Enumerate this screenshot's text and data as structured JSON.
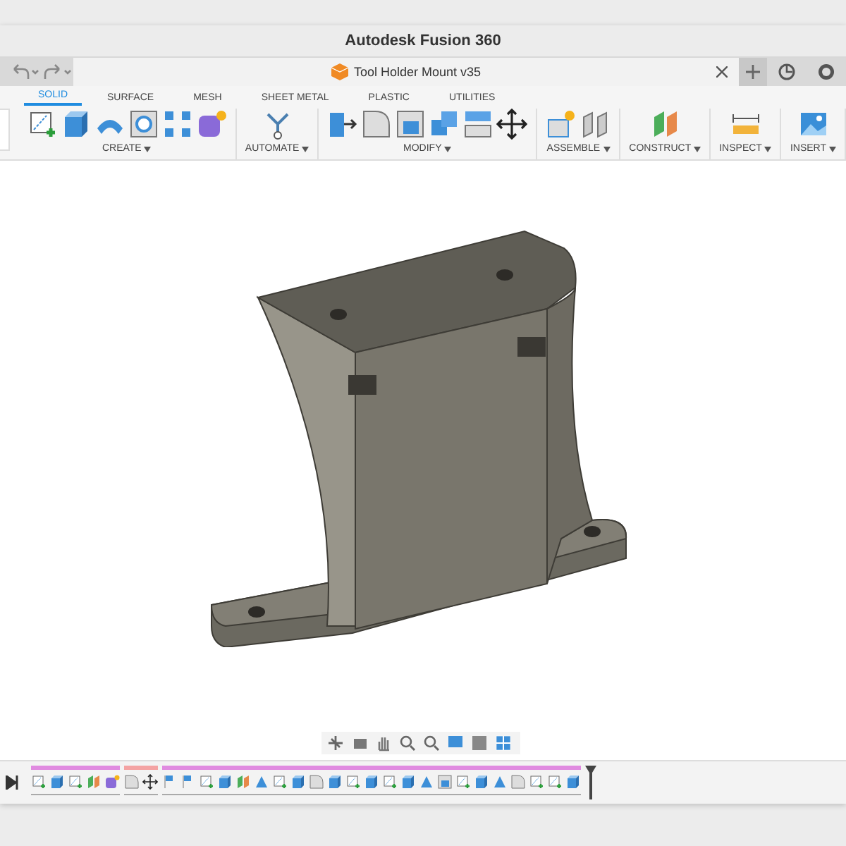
{
  "window": {
    "title": "Autodesk Fusion 360"
  },
  "document_tab": {
    "title": "Tool Holder Mount v35"
  },
  "workspace_tabs": [
    {
      "label": "SOLID",
      "selected": true
    },
    {
      "label": "SURFACE",
      "selected": false
    },
    {
      "label": "MESH",
      "selected": false
    },
    {
      "label": "SHEET METAL",
      "selected": false
    },
    {
      "label": "PLASTIC",
      "selected": false
    },
    {
      "label": "UTILITIES",
      "selected": false
    }
  ],
  "toolbar_groups": [
    {
      "label": "CREATE",
      "tools": [
        {
          "kind": "sketch"
        },
        {
          "kind": "extrude"
        },
        {
          "kind": "revolve"
        },
        {
          "kind": "hole"
        },
        {
          "kind": "pattern"
        },
        {
          "kind": "form"
        }
      ]
    },
    {
      "label": "AUTOMATE",
      "tools": [
        {
          "kind": "automate"
        }
      ]
    },
    {
      "label": "MODIFY",
      "tools": [
        {
          "kind": "presspull"
        },
        {
          "kind": "fillet"
        },
        {
          "kind": "shell"
        },
        {
          "kind": "combine"
        },
        {
          "kind": "offset"
        },
        {
          "kind": "move"
        }
      ]
    },
    {
      "label": "ASSEMBLE",
      "tools": [
        {
          "kind": "component"
        },
        {
          "kind": "joint"
        }
      ]
    },
    {
      "label": "CONSTRUCT",
      "tools": [
        {
          "kind": "plane"
        }
      ]
    },
    {
      "label": "INSPECT",
      "tools": [
        {
          "kind": "measure"
        }
      ]
    },
    {
      "label": "INSERT",
      "tools": [
        {
          "kind": "image"
        }
      ]
    }
  ],
  "timeline_groups": [
    {
      "color": "#e08be0",
      "items": [
        {
          "kind": "sketch"
        },
        {
          "kind": "extrude"
        },
        {
          "kind": "sketch"
        },
        {
          "kind": "plane"
        },
        {
          "kind": "form"
        }
      ]
    },
    {
      "color": "#f4a3a3",
      "items": [
        {
          "kind": "fillet"
        },
        {
          "kind": "move"
        }
      ]
    },
    {
      "color": "#e08be0",
      "items": [
        {
          "kind": "flag"
        },
        {
          "kind": "flag"
        },
        {
          "kind": "sketch"
        },
        {
          "kind": "extrude"
        },
        {
          "kind": "plane"
        },
        {
          "kind": "draft"
        },
        {
          "kind": "sketch"
        },
        {
          "kind": "extrude"
        },
        {
          "kind": "fillet"
        },
        {
          "kind": "extrude"
        },
        {
          "kind": "sketch"
        },
        {
          "kind": "extrude"
        },
        {
          "kind": "sketch"
        },
        {
          "kind": "extrude"
        },
        {
          "kind": "draft"
        },
        {
          "kind": "shell"
        },
        {
          "kind": "sketch"
        },
        {
          "kind": "extrude"
        },
        {
          "kind": "draft"
        },
        {
          "kind": "fillet"
        },
        {
          "kind": "sketch"
        },
        {
          "kind": "sketch"
        },
        {
          "kind": "extrude"
        }
      ]
    }
  ]
}
